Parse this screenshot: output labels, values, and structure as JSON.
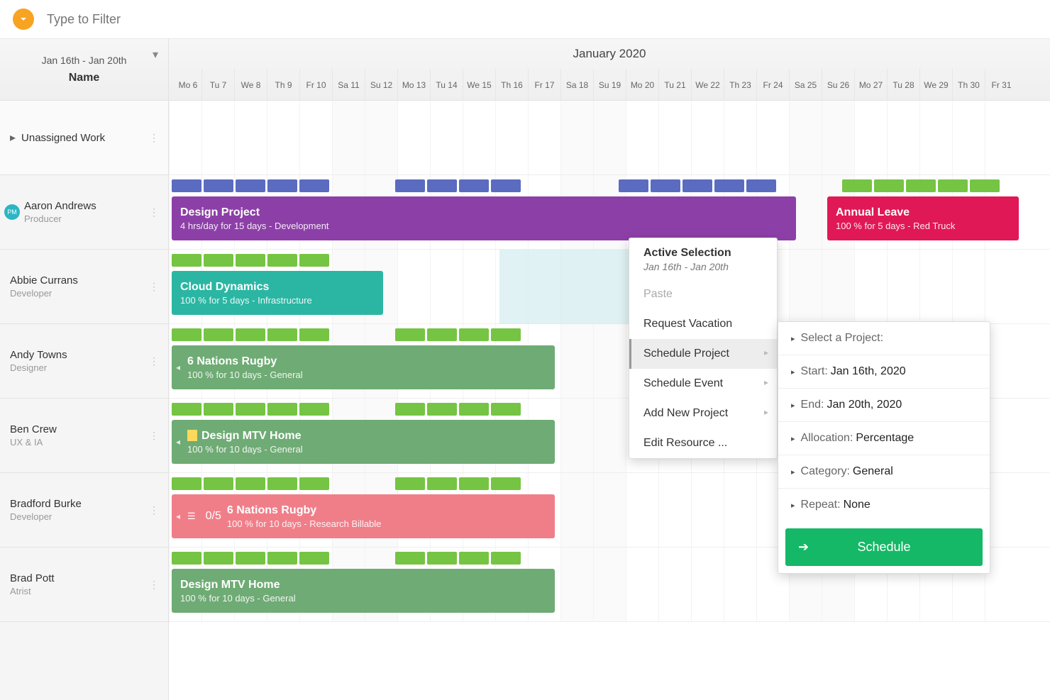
{
  "filter_placeholder": "Type to Filter",
  "left_header": {
    "range": "Jan 16th - Jan 20th",
    "name_label": "Name"
  },
  "month_label": "January 2020",
  "days": [
    "Mo 6",
    "Tu 7",
    "We 8",
    "Th 9",
    "Fr 10",
    "Sa 11",
    "Su 12",
    "Mo 13",
    "Tu 14",
    "We 15",
    "Th 16",
    "Fr 17",
    "Sa 18",
    "Su 19",
    "Mo 20",
    "Tu 21",
    "We 22",
    "Th 23",
    "Fr 24",
    "Sa 25",
    "Su 26",
    "Mo 27",
    "Tu 28",
    "We 29",
    "Th 30",
    "Fr 31"
  ],
  "weekend_indices": [
    5,
    6,
    12,
    13,
    19,
    20
  ],
  "unassigned_label": "Unassigned Work",
  "resources": [
    {
      "name": "Aaron Andrews",
      "role": "Producer",
      "pm": true
    },
    {
      "name": "Abbie Currans",
      "role": "Developer"
    },
    {
      "name": "Andy Towns",
      "role": "Designer"
    },
    {
      "name": "Ben Crew",
      "role": "UX & IA"
    },
    {
      "name": "Bradford Burke",
      "role": "Developer"
    },
    {
      "name": "Brad Pott",
      "role": "Atrist"
    }
  ],
  "bars": {
    "aaron_design": {
      "title": "Design Project",
      "sub": "4 hrs/day for 15 days - Development"
    },
    "aaron_leave": {
      "title": "Annual Leave",
      "sub": "100 % for 5 days - Red Truck"
    },
    "abbie_cloud": {
      "title": "Cloud Dynamics",
      "sub": "100 % for 5 days - Infrastructure"
    },
    "andy_rugby": {
      "title": "6 Nations Rugby",
      "sub": "100 % for 10 days - General"
    },
    "ben_mtv": {
      "title": "Design MTV Home",
      "sub": "100 % for 10 days - General"
    },
    "brad_rugby": {
      "title": "6 Nations Rugby",
      "sub": "100 % for 10 days - Research Billable",
      "count": "0/5"
    },
    "pott_mtv": {
      "title": "Design MTV Home",
      "sub": "100 % for 10 days - General"
    }
  },
  "ctx": {
    "header_title": "Active Selection",
    "header_range": "Jan 16th - Jan 20th",
    "paste": "Paste",
    "vacation": "Request Vacation",
    "schedule_project": "Schedule Project",
    "schedule_event": "Schedule Event",
    "add_new": "Add New Project",
    "edit_resource": "Edit Resource ..."
  },
  "sub": {
    "select_project": "Select a Project:",
    "start_label": "Start:",
    "start_val": "Jan 16th, 2020",
    "end_label": "End:",
    "end_val": "Jan 20th, 2020",
    "alloc_label": "Allocation:",
    "alloc_val": "Percentage",
    "cat_label": "Category:",
    "cat_val": "General",
    "repeat_label": "Repeat:",
    "repeat_val": "None",
    "button": "Schedule"
  }
}
